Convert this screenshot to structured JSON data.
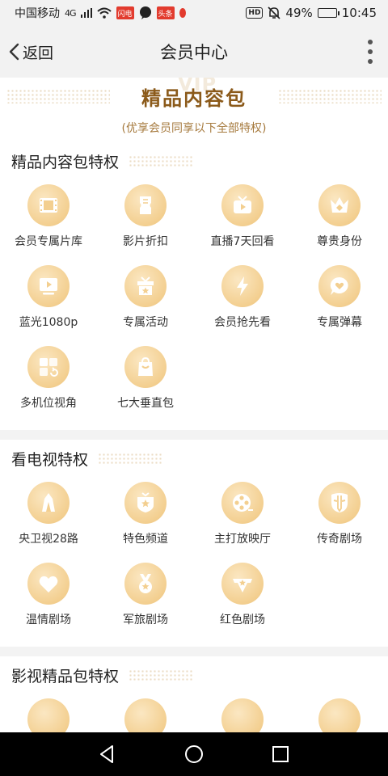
{
  "status_bar": {
    "carrier": "中国移动",
    "network": "4G",
    "badge_app1": "闪电",
    "badge_app2": "头条",
    "hd": "HD",
    "battery_percent": "49%",
    "battery_level": 0.49,
    "time": "10:45"
  },
  "nav": {
    "back_label": "返回",
    "title": "会员中心"
  },
  "hero": {
    "watermark": "VIP",
    "title": "精品内容包",
    "subtitle": "(优享会员同享以下全部特权)"
  },
  "sections": [
    {
      "title": "精品内容包特权",
      "items": [
        {
          "label": "会员专属片库",
          "icon": "film-strip-icon"
        },
        {
          "label": "影片折扣",
          "icon": "ticket-icon"
        },
        {
          "label": "直播7天回看",
          "icon": "tv-play-icon"
        },
        {
          "label": "尊贵身份",
          "icon": "crown-icon"
        },
        {
          "label": "蓝光1080p",
          "icon": "monitor-play-icon"
        },
        {
          "label": "专属活动",
          "icon": "gift-star-icon"
        },
        {
          "label": "会员抢先看",
          "icon": "lightning-icon"
        },
        {
          "label": "专属弹幕",
          "icon": "chat-heart-icon"
        },
        {
          "label": "多机位视角",
          "icon": "multi-camera-icon"
        },
        {
          "label": "七大垂直包",
          "icon": "bag-icon"
        }
      ]
    },
    {
      "title": "看电视特权",
      "items": [
        {
          "label": "央卫视28路",
          "icon": "tower-icon"
        },
        {
          "label": "特色频道",
          "icon": "shield-star-icon"
        },
        {
          "label": "主打放映厅",
          "icon": "film-reel-icon"
        },
        {
          "label": "传奇剧场",
          "icon": "mask-icon"
        },
        {
          "label": "温情剧场",
          "icon": "heart-icon"
        },
        {
          "label": "军旅剧场",
          "icon": "medal-icon"
        },
        {
          "label": "红色剧场",
          "icon": "wing-star-icon"
        }
      ]
    },
    {
      "title": "影视精品包特权"
    }
  ],
  "colors": {
    "accent_brown": "#8b5a1a",
    "icon_gold": "#f3cf90",
    "icon_glyph": "#ffffff"
  }
}
